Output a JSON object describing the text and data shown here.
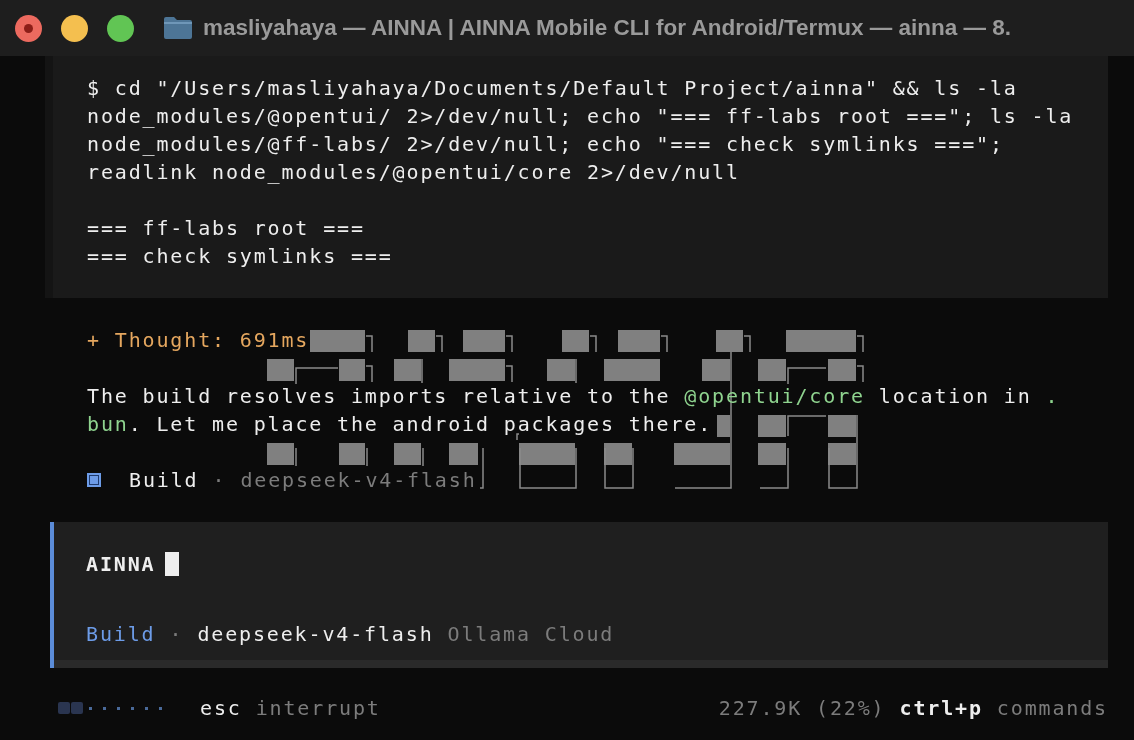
{
  "window": {
    "title": "masliyahaya — AINNA | AINNA Mobile CLI for Android/Termux — ainna — 8."
  },
  "tool_output": {
    "command_lines": [
      "$ cd \"/Users/masliyahaya/Documents/Default Project/ainna\" && ls -la",
      "node_modules/@opentui/ 2>/dev/null; echo \"=== ff-labs root ===\"; ls -la",
      "node_modules/@ff-labs/ 2>/dev/null; echo \"=== check symlinks ===\";",
      "readlink node_modules/@opentui/core 2>/dev/null"
    ],
    "output_lines": [
      "=== ff-labs root ===",
      "=== check symlinks ==="
    ]
  },
  "thought": {
    "text": "+ Thought: 691ms"
  },
  "message": {
    "lines": [
      [
        {
          "kind": "plain",
          "text": "The build resolves imports relative to the "
        },
        {
          "kind": "code",
          "text": "@opentui/core"
        },
        {
          "kind": "plain",
          "text": " location in "
        },
        {
          "kind": "code",
          "text": "."
        }
      ],
      [
        {
          "kind": "code",
          "text": "bun"
        },
        {
          "kind": "plain",
          "text": ". Let me place the android packages there."
        }
      ]
    ]
  },
  "agent_footer": {
    "mode": "Build",
    "separator": "·",
    "model": "deepseek-v4-flash"
  },
  "prompt": {
    "value": "AINNA",
    "mode": "Build",
    "separator": "·",
    "model": "deepseek-v4-flash",
    "provider": "Ollama Cloud"
  },
  "status_bar": {
    "key": "esc",
    "action": "interrupt",
    "usage": "227.9K (22%)",
    "shortcut_key": "ctrl+p",
    "shortcut_action": "commands"
  }
}
